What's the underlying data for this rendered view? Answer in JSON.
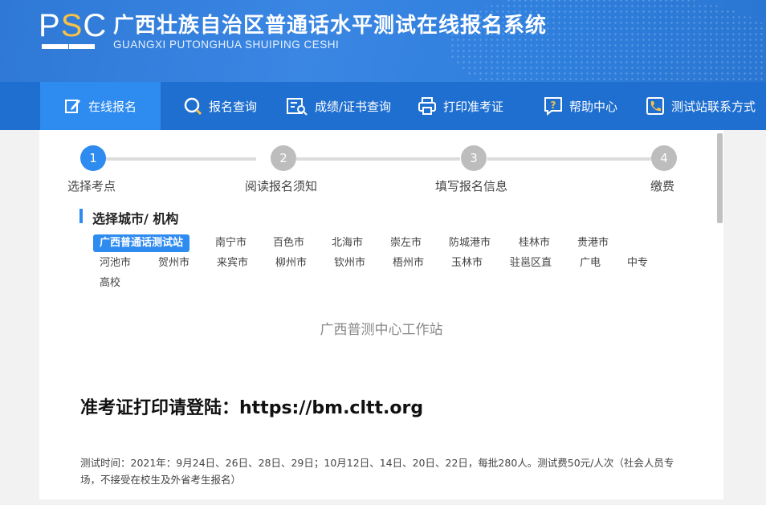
{
  "header": {
    "logo_text": "PSC",
    "title": "广西壮族自治区普通话水平测试在线报名系统",
    "subtitle": "GUANGXI PUTONGHUA SHUIPING CESHI"
  },
  "nav": {
    "items": [
      {
        "label": "在线报名",
        "icon": "edit-icon",
        "active": true
      },
      {
        "label": "报名查询",
        "icon": "search-icon"
      },
      {
        "label": "成绩/证书查询",
        "icon": "certificate-search-icon"
      },
      {
        "label": "打印准考证",
        "icon": "printer-icon"
      },
      {
        "label": "帮助中心",
        "icon": "help-icon"
      },
      {
        "label": "测试站联系方式",
        "icon": "phone-icon"
      }
    ]
  },
  "steps": [
    {
      "number": "1",
      "label": "选择考点",
      "active": true
    },
    {
      "number": "2",
      "label": "阅读报名须知"
    },
    {
      "number": "3",
      "label": "填写报名信息"
    },
    {
      "number": "4",
      "label": "缴费"
    }
  ],
  "section": {
    "title": "选择城市/ 机构"
  },
  "cities": [
    "广西普通话测试站",
    "南宁市",
    "百色市",
    "北海市",
    "崇左市",
    "防城港市",
    "桂林市",
    "贵港市",
    "河池市",
    "贺州市",
    "来宾市",
    "柳州市",
    "钦州市",
    "梧州市",
    "玉林市",
    "驻邕区直",
    "广电",
    "中专",
    "高校"
  ],
  "content": {
    "center_message": "广西普测中心工作站",
    "print_note": "准考证打印请登陆：https://bm.cltt.org",
    "test_time": "测试时间：2021年：9月24日、26日、28日、29日；10月12日、14日、20日、22日，每批280人。测试费50元/人次（社会人员专场，不接受在校生及外省考生报名）"
  },
  "colors": {
    "primary": "#2e8bf0",
    "nav_bg": "#1f6fd0",
    "logo_accent": "#f7c245",
    "step_inactive": "#bdbdbd"
  }
}
